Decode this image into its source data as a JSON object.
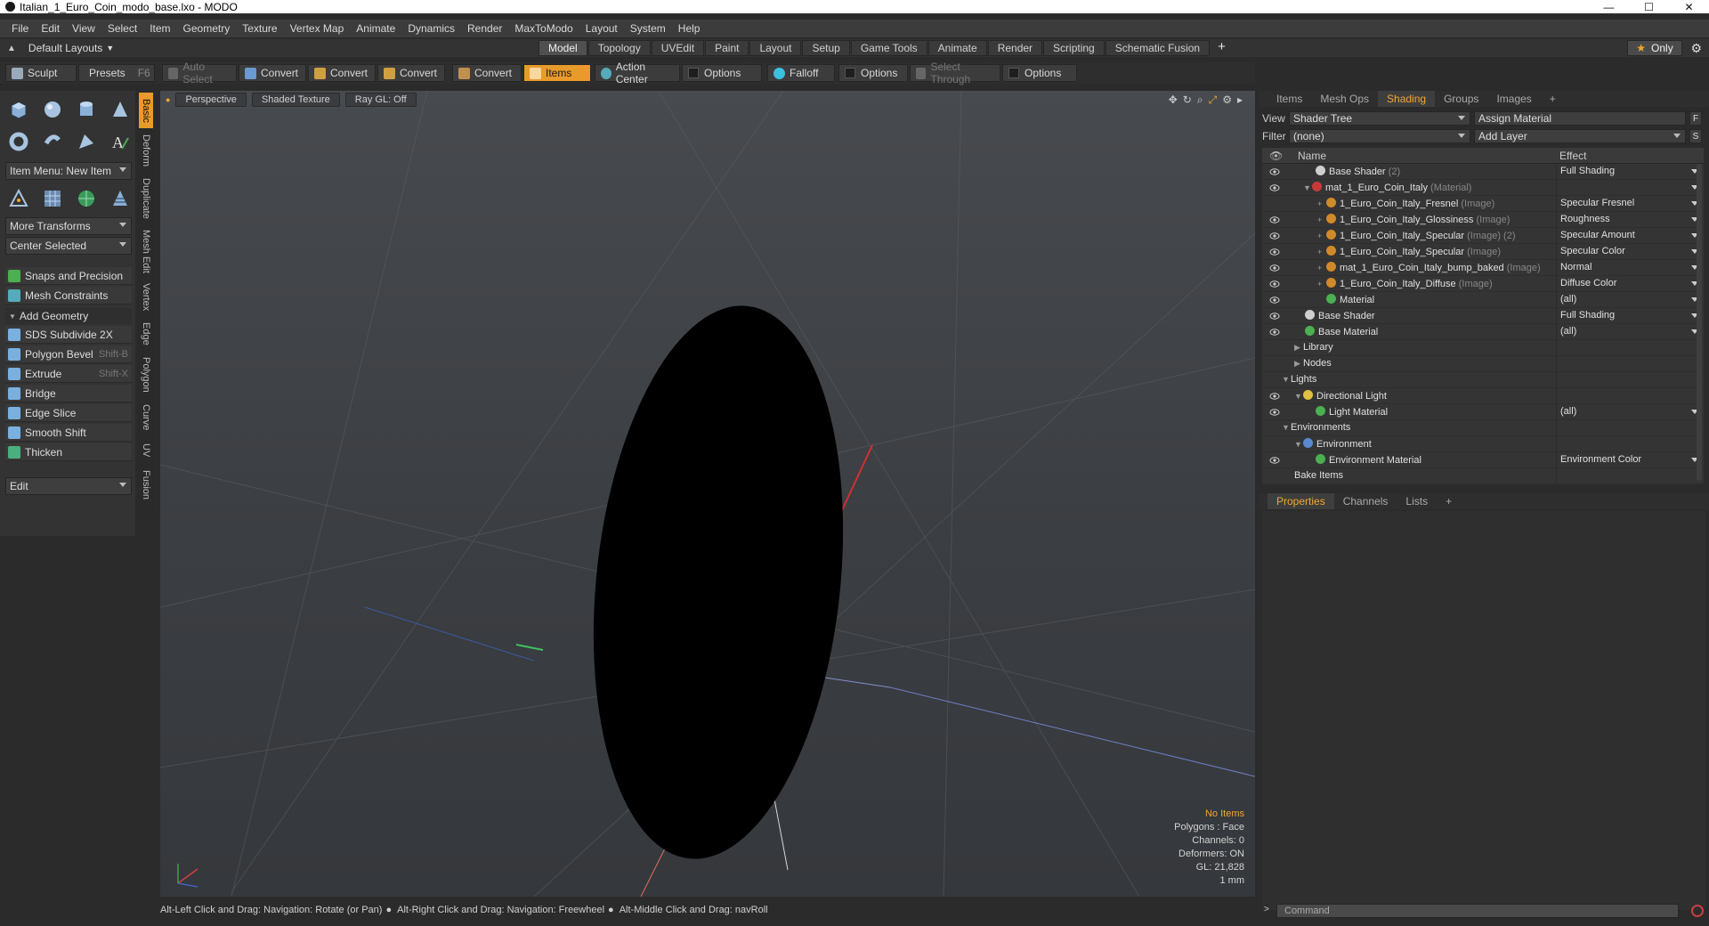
{
  "window": {
    "title": "Italian_1_Euro_Coin_modo_base.lxo - MODO",
    "controls": [
      "—",
      "☐",
      "✕"
    ]
  },
  "menubar": [
    "File",
    "Edit",
    "View",
    "Select",
    "Item",
    "Geometry",
    "Texture",
    "Vertex Map",
    "Animate",
    "Dynamics",
    "Render",
    "MaxToModo",
    "Layout",
    "System",
    "Help"
  ],
  "layoutbar": {
    "layout_label": "Default Layouts",
    "tabs": [
      "Model",
      "Topology",
      "UVEdit",
      "Paint",
      "Layout",
      "Setup",
      "Game Tools",
      "Animate",
      "Render",
      "Scripting",
      "Schematic Fusion"
    ],
    "active_tab": "Model",
    "plus": "+",
    "only_label": "Only"
  },
  "toolbar": {
    "sculpt": "Sculpt",
    "presets": "Presets",
    "presets_key": "F6",
    "auto_select": "Auto Select",
    "convert1": "Convert",
    "convert2": "Convert",
    "convert3": "Convert",
    "convert4": "Convert",
    "items": "Items",
    "action_center": "Action Center",
    "options1": "Options",
    "falloff": "Falloff",
    "options2": "Options",
    "select_through": "Select Through",
    "options3": "Options"
  },
  "leftpanel": {
    "item_menu": "Item Menu: New Item",
    "more_transforms": "More Transforms",
    "center_selected": "Center Selected",
    "snaps": "Snaps and Precision",
    "mesh_constraints": "Mesh Constraints",
    "add_geometry": "Add Geometry",
    "tools": [
      {
        "label": "SDS Subdivide 2X",
        "shortcut": ""
      },
      {
        "label": "Polygon Bevel",
        "shortcut": "Shift-B"
      },
      {
        "label": "Extrude",
        "shortcut": "Shift-X"
      },
      {
        "label": "Bridge",
        "shortcut": ""
      },
      {
        "label": "Edge Slice",
        "shortcut": ""
      },
      {
        "label": "Smooth Shift",
        "shortcut": ""
      },
      {
        "label": "Thicken",
        "shortcut": ""
      }
    ],
    "edit": "Edit",
    "side_tabs": [
      "Basic",
      "Deform",
      "Duplicate",
      "Mesh Edit",
      "Vertex",
      "Edge",
      "Polygon",
      "Curve",
      "UV",
      "Fusion"
    ]
  },
  "viewport": {
    "view_mode": "Perspective",
    "shading": "Shaded Texture",
    "raygl": "Ray GL: Off",
    "stats": {
      "no_items": "No Items",
      "polygons": "Polygons : Face",
      "channels": "Channels: 0",
      "deformers": "Deformers: ON",
      "gl": "GL: 21,828",
      "unit": "1 mm"
    }
  },
  "statusbar": {
    "hint1": "Alt-Left Click and Drag: Navigation: Rotate (or Pan)",
    "hint2": "Alt-Right Click and Drag: Navigation: Freewheel",
    "hint3": "Alt-Middle Click and Drag: navRoll"
  },
  "rightpanel": {
    "tabs": [
      "Items",
      "Mesh Ops",
      "Shading",
      "Groups",
      "Images",
      "+"
    ],
    "active_tab": "Shading",
    "view_label": "View",
    "view_value": "Shader Tree",
    "assign_material": "Assign Material",
    "f_btn": "F",
    "filter_label": "Filter",
    "filter_value": "(none)",
    "add_layer": "Add Layer",
    "s_btn": "S",
    "col_name": "Name",
    "col_effect": "Effect",
    "rows": [
      {
        "name": "Base Shader",
        "hint": "(2)",
        "effect": "Full Shading",
        "indent": 60,
        "icon": "#cfcfcf",
        "exp": "",
        "eye": true
      },
      {
        "name": "mat_1_Euro_Coin_Italy",
        "hint": "(Material)",
        "effect": "",
        "indent": 46,
        "icon": "#c83a3a",
        "exp": "▼",
        "eye": true
      },
      {
        "name": "1_Euro_Coin_Italy_Fresnel",
        "hint": "(Image)",
        "effect": "Specular Fresnel",
        "indent": 62,
        "icon": "#d08a28",
        "exp": "+",
        "eye": false
      },
      {
        "name": "1_Euro_Coin_Italy_Glossiness",
        "hint": "(Image)",
        "effect": "Roughness",
        "indent": 62,
        "icon": "#d08a28",
        "exp": "+",
        "eye": true
      },
      {
        "name": "1_Euro_Coin_Italy_Specular",
        "hint": "(Image) (2)",
        "effect": "Specular Amount",
        "indent": 62,
        "icon": "#d08a28",
        "exp": "+",
        "eye": true
      },
      {
        "name": "1_Euro_Coin_Italy_Specular",
        "hint": "(Image)",
        "effect": "Specular Color",
        "indent": 62,
        "icon": "#d08a28",
        "exp": "+",
        "eye": true
      },
      {
        "name": "mat_1_Euro_Coin_Italy_bump_baked",
        "hint": "(Image)",
        "effect": "Normal",
        "indent": 62,
        "icon": "#d08a28",
        "exp": "+",
        "eye": true
      },
      {
        "name": "1_Euro_Coin_Italy_Diffuse",
        "hint": "(Image)",
        "effect": "Diffuse Color",
        "indent": 62,
        "icon": "#d08a28",
        "exp": "+",
        "eye": true
      },
      {
        "name": "Material",
        "hint": "",
        "effect": "(all)",
        "indent": 72,
        "icon": "#4caf50",
        "exp": "",
        "eye": true
      },
      {
        "name": "Base Shader",
        "hint": "",
        "effect": "Full Shading",
        "indent": 48,
        "icon": "#cfcfcf",
        "exp": "",
        "eye": true
      },
      {
        "name": "Base Material",
        "hint": "",
        "effect": "(all)",
        "indent": 48,
        "icon": "#4caf50",
        "exp": "",
        "eye": true
      },
      {
        "name": "Library",
        "hint": "",
        "effect": "",
        "indent": 36,
        "icon": "",
        "exp": "▶",
        "eye": false
      },
      {
        "name": "Nodes",
        "hint": "",
        "effect": "",
        "indent": 36,
        "icon": "",
        "exp": "▶",
        "eye": false
      },
      {
        "name": "Lights",
        "hint": "",
        "effect": "",
        "indent": 22,
        "icon": "",
        "exp": "▼",
        "eye": false
      },
      {
        "name": "Directional Light",
        "hint": "",
        "effect": "",
        "indent": 36,
        "icon": "#e0c040",
        "exp": "▼",
        "eye": true
      },
      {
        "name": "Light Material",
        "hint": "",
        "effect": "(all)",
        "indent": 60,
        "icon": "#4caf50",
        "exp": "",
        "eye": true
      },
      {
        "name": "Environments",
        "hint": "",
        "effect": "",
        "indent": 22,
        "icon": "",
        "exp": "▼",
        "eye": false
      },
      {
        "name": "Environment",
        "hint": "",
        "effect": "",
        "indent": 36,
        "icon": "#5a8ad0",
        "exp": "▼",
        "eye": false
      },
      {
        "name": "Environment Material",
        "hint": "",
        "effect": "Environment Color",
        "indent": 60,
        "icon": "#4caf50",
        "exp": "",
        "eye": true
      },
      {
        "name": "Bake Items",
        "hint": "",
        "effect": "",
        "indent": 36,
        "icon": "",
        "exp": "",
        "eye": false
      }
    ],
    "prop_tabs": [
      "Properties",
      "Channels",
      "Lists",
      "+"
    ],
    "active_prop_tab": "Properties"
  },
  "command": {
    "placeholder": "Command"
  },
  "colors": {
    "accent": "#e89a2a",
    "panel": "#333333",
    "viewport_bg": "#424549"
  }
}
